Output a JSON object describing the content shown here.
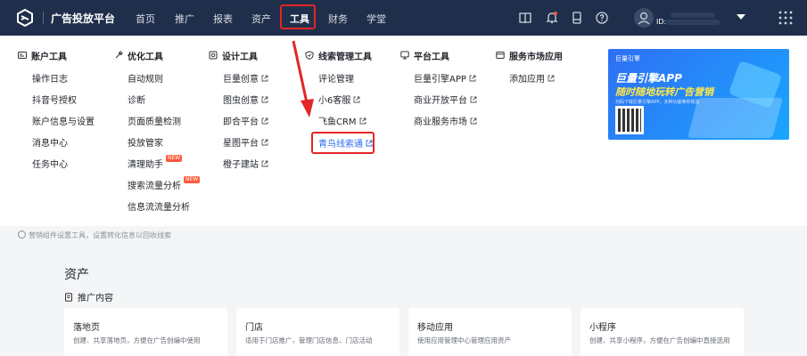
{
  "topbar": {
    "brand": "广告投放平台",
    "nav": [
      "首页",
      "推广",
      "报表",
      "资产",
      "工具",
      "财务",
      "学堂"
    ],
    "active_nav": "工具",
    "icons": [
      "book-icon",
      "bell-icon",
      "device-icon",
      "help-icon",
      "user-icon",
      "grid-icon"
    ],
    "user_id_label": "ID:"
  },
  "menu": {
    "columns": [
      {
        "title": "账户工具",
        "icon": "card-icon",
        "items": [
          {
            "label": "操作日志"
          },
          {
            "label": "抖音号授权"
          },
          {
            "label": "账户信息与设置"
          },
          {
            "label": "消息中心"
          },
          {
            "label": "任务中心"
          }
        ]
      },
      {
        "title": "优化工具",
        "icon": "wrench-icon",
        "items": [
          {
            "label": "自动规则"
          },
          {
            "label": "诊断"
          },
          {
            "label": "页面质量检测"
          },
          {
            "label": "投放管家"
          },
          {
            "label": "清理助手",
            "badge": "NEW"
          },
          {
            "label": "搜索流量分析",
            "badge": "NEW"
          },
          {
            "label": "信息流流量分析"
          }
        ]
      },
      {
        "title": "设计工具",
        "icon": "design-icon",
        "items": [
          {
            "label": "巨量创意",
            "external": true
          },
          {
            "label": "图虫创意",
            "external": true
          },
          {
            "label": "即合平台",
            "external": true
          },
          {
            "label": "星图平台",
            "external": true
          },
          {
            "label": "橙子建站",
            "external": true
          }
        ]
      },
      {
        "title": "线索管理工具",
        "icon": "shield-icon",
        "items": [
          {
            "label": "评论管理"
          },
          {
            "label": "小6客服",
            "external": true
          },
          {
            "label": "飞鱼CRM",
            "external": true
          },
          {
            "label": "青鸟线索通",
            "external": true,
            "highlighted": true
          }
        ]
      },
      {
        "title": "平台工具",
        "icon": "monitor-icon",
        "items": [
          {
            "label": "巨量引擎APP",
            "external": true
          },
          {
            "label": "商业开放平台",
            "external": true
          },
          {
            "label": "商业服务市场",
            "external": true
          }
        ]
      },
      {
        "title": "服务市场应用",
        "icon": "app-icon",
        "items": [
          {
            "label": "添加应用",
            "external": true
          }
        ]
      }
    ],
    "banner": {
      "logo": "巨量引擎",
      "line1": "巨量引擎APP",
      "line2": "随时随地玩转广告营销",
      "small": "扫码下载巨量引擎APP，多种功能等你体验"
    }
  },
  "tip": "营销组件设置工具，设置转化信息以回收线索",
  "assets": {
    "title": "资产",
    "subtitle": "推广内容",
    "cards": [
      {
        "title": "落地页",
        "desc": "创建、共享落地页，方便在广告创编中使用"
      },
      {
        "title": "门店",
        "desc": "适用于门店推广，管理门店信息、门店活动"
      },
      {
        "title": "移动应用",
        "desc": "使用应用管理中心管理应用资产"
      },
      {
        "title": "小程序",
        "desc": "创建、共享小程序，方便在广告创编中直接选用"
      }
    ]
  },
  "colors": {
    "nav_bg": "#1f2f4b",
    "link": "#2a6bf2",
    "highlight": "#e22626",
    "badge": "#ff5a3c"
  }
}
